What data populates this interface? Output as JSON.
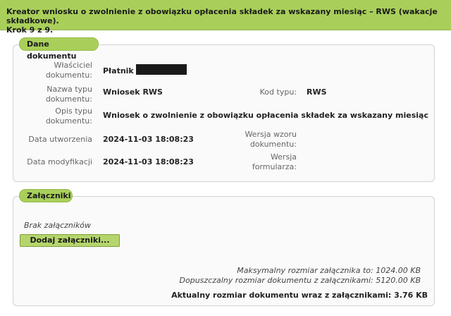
{
  "header": {
    "title": "Kreator wniosku o zwolnienie z obowiązku opłacenia składek za wskazany miesiąc – RWS (wakacje składkowe).",
    "step": "Krok 9 z 9."
  },
  "document_panel": {
    "title": "Dane dokumentu",
    "owner_label": "Właściciel dokumentu:",
    "owner_value": "Płatnik -",
    "type_name_label": "Nazwa typu dokumentu:",
    "type_name_value": "Wniosek RWS",
    "type_code_label": "Kod typu:",
    "type_code_value": "RWS",
    "type_desc_label": "Opis typu dokumentu:",
    "type_desc_value": "Wniosek o zwolnienie z obowiązku opłacenia składek za wskazany miesiąc",
    "created_label": "Data utworzenia",
    "created_value": "2024-11-03 18:08:23",
    "template_version_label": "Wersja wzoru dokumentu:",
    "template_version_value": "",
    "modified_label": "Data modyfikacji",
    "modified_value": "2024-11-03 18:08:23",
    "form_version_label": "Wersja formularza:",
    "form_version_value": ""
  },
  "attachments_panel": {
    "title": "Załączniki",
    "empty_text": "Brak załączników",
    "add_button": "Dodaj załączniki...",
    "max_attachment_size": "Maksymalny rozmiar załącznika to: 1024.00 KB",
    "max_document_size": "Dopuszczalny rozmiar dokumentu z załącznikami: 5120.00 KB",
    "current_size": "Aktualny rozmiar dokumentu wraz z załącznikami: 3.76 KB"
  },
  "colors": {
    "accent_green": "#a9cf5a",
    "redaction": "#1a1a1a"
  }
}
